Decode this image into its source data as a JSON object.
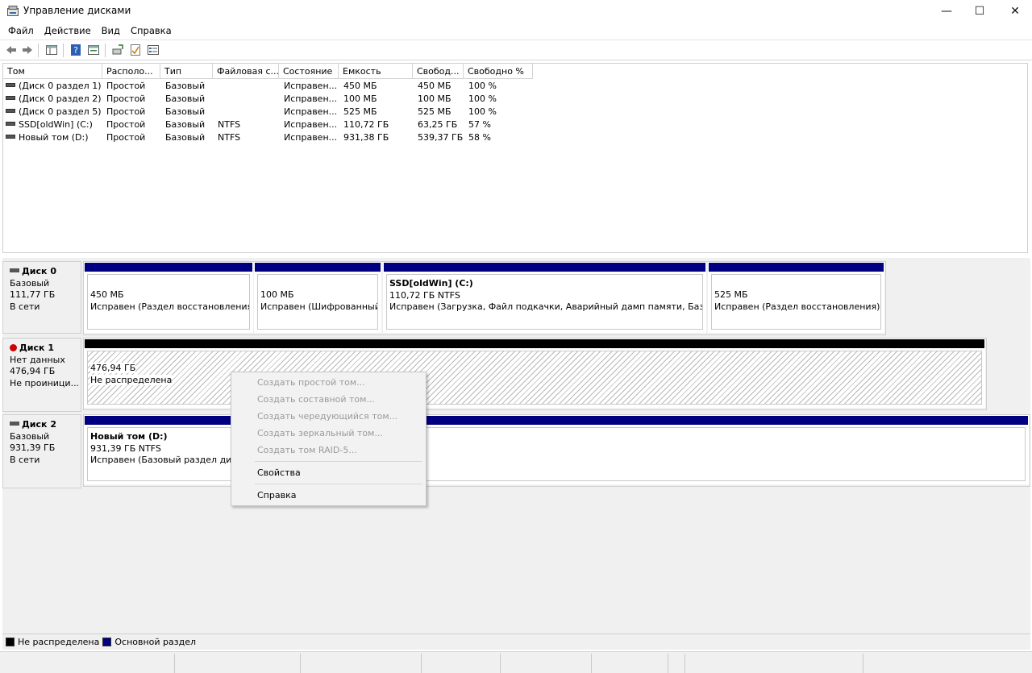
{
  "window": {
    "title": "Управление дисками",
    "min_glyph": "—",
    "max_glyph": "☐",
    "close_glyph": "✕"
  },
  "menu": [
    {
      "label": "Файл"
    },
    {
      "label": "Действие"
    },
    {
      "label": "Вид"
    },
    {
      "label": "Справка"
    }
  ],
  "toolbar": {
    "icons": [
      "back-icon",
      "forward-icon",
      "show-hide-console-tree-icon",
      "help-icon",
      "properties-icon",
      "connect-icon",
      "check-icon",
      "list-icon"
    ]
  },
  "list": {
    "columns": [
      "Том",
      "Располо...",
      "Тип",
      "Файловая с...",
      "Состояние",
      "Емкость",
      "Свобод...",
      "Свободно %"
    ],
    "rows": [
      {
        "volume": "(Диск 0 раздел 1)",
        "layout": "Простой",
        "type": "Базовый",
        "fs": "",
        "status": "Исправен...",
        "capacity": "450 МБ",
        "free": "450 МБ",
        "free_pct": "100 %"
      },
      {
        "volume": "(Диск 0 раздел 2)",
        "layout": "Простой",
        "type": "Базовый",
        "fs": "",
        "status": "Исправен...",
        "capacity": "100 МБ",
        "free": "100 МБ",
        "free_pct": "100 %"
      },
      {
        "volume": "(Диск 0 раздел 5)",
        "layout": "Простой",
        "type": "Базовый",
        "fs": "",
        "status": "Исправен...",
        "capacity": "525 МБ",
        "free": "525 МБ",
        "free_pct": "100 %"
      },
      {
        "volume": "SSD[oldWin] (C:)",
        "layout": "Простой",
        "type": "Базовый",
        "fs": "NTFS",
        "status": "Исправен...",
        "capacity": "110,72 ГБ",
        "free": "63,25 ГБ",
        "free_pct": "57 %"
      },
      {
        "volume": "Новый том (D:)",
        "layout": "Простой",
        "type": "Базовый",
        "fs": "NTFS",
        "status": "Исправен...",
        "capacity": "931,38 ГБ",
        "free": "539,37 ГБ",
        "free_pct": "58 %"
      }
    ]
  },
  "disks": {
    "disk0": {
      "name": "Диск 0",
      "kind": "Базовый",
      "size": "111,77 ГБ",
      "state": "В сети",
      "parts": [
        {
          "title": "",
          "size": "450 МБ",
          "status": "Исправен (Раздел восстановления)"
        },
        {
          "title": "",
          "size": "100 МБ",
          "status": "Исправен (Шифрованный ("
        },
        {
          "title": "SSD[oldWin]  (C:)",
          "size": "110,72 ГБ NTFS",
          "status": "Исправен (Загрузка, Файл подкачки, Аварийный дамп памяти, Базовый р"
        },
        {
          "title": "",
          "size": "525 МБ",
          "status": "Исправен (Раздел восстановления)"
        }
      ]
    },
    "disk1": {
      "name": "Диск 1",
      "kind": "Нет данных",
      "size": "476,94 ГБ",
      "state": "Не проиници...",
      "part": {
        "size": "476,94 ГБ",
        "status": "Не распределена"
      }
    },
    "disk2": {
      "name": "Диск 2",
      "kind": "Базовый",
      "size": "931,39 ГБ",
      "state": "В сети",
      "part": {
        "title": "Новый том  (D:)",
        "size": "931,39 ГБ NTFS",
        "status": "Исправен (Базовый раздел диска)"
      }
    }
  },
  "context_menu": {
    "items": [
      {
        "label": "Создать простой том...",
        "enabled": false
      },
      {
        "label": "Создать составной том...",
        "enabled": false
      },
      {
        "label": "Создать чередующийся том...",
        "enabled": false
      },
      {
        "label": "Создать зеркальный том...",
        "enabled": false
      },
      {
        "label": "Создать том RAID-5...",
        "enabled": false
      },
      {
        "label": "Свойства",
        "enabled": true
      },
      {
        "label": "Справка",
        "enabled": true
      }
    ]
  },
  "legend": [
    {
      "label": "Не распределена",
      "color": "#000000"
    },
    {
      "label": "Основной раздел",
      "color": "#000080"
    }
  ]
}
